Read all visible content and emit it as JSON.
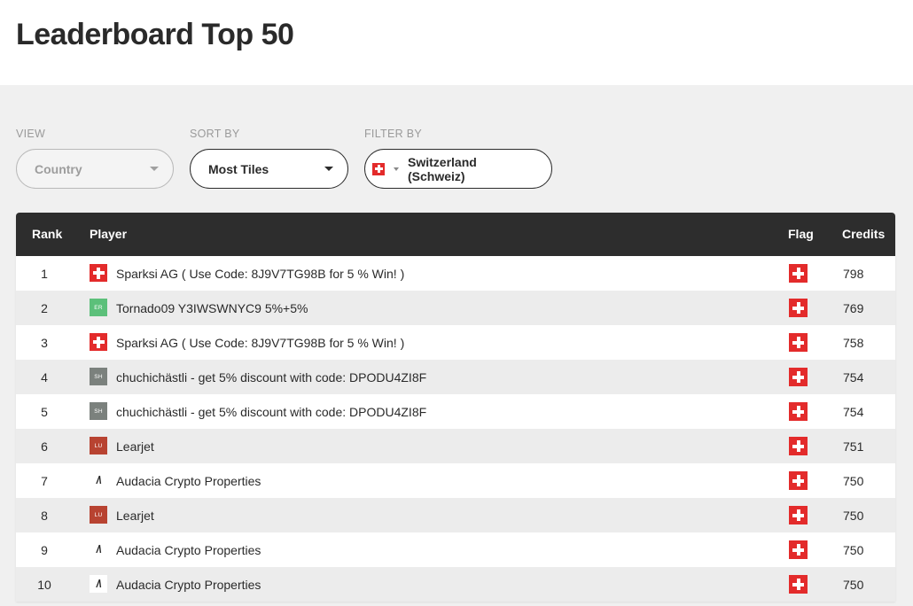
{
  "page": {
    "title": "Leaderboard Top 50"
  },
  "controls": {
    "view": {
      "label": "VIEW",
      "value": "Country",
      "disabled": true
    },
    "sort": {
      "label": "SORT BY",
      "value": "Most Tiles"
    },
    "filter": {
      "label": "FILTER BY",
      "value": "Switzerland (Schweiz)",
      "flag": "swiss-flag"
    }
  },
  "table": {
    "headers": {
      "rank": "Rank",
      "player": "Player",
      "flag": "Flag",
      "credits": "Credits"
    },
    "rows": [
      {
        "rank": "1",
        "avatar": "swiss-flag",
        "avatar_text": "",
        "player": "Sparksi AG ( Use Code: 8J9V7TG98B for 5 % Win! )",
        "flag": "swiss-flag",
        "credits": "798"
      },
      {
        "rank": "2",
        "avatar": "er",
        "avatar_text": "ER",
        "player": "Tornado09 Y3IWSWNYC9 5%+5%",
        "flag": "swiss-flag",
        "credits": "769"
      },
      {
        "rank": "3",
        "avatar": "swiss-flag",
        "avatar_text": "",
        "player": "Sparksi AG ( Use Code: 8J9V7TG98B for 5 % Win! )",
        "flag": "swiss-flag",
        "credits": "758"
      },
      {
        "rank": "4",
        "avatar": "sh",
        "avatar_text": "SH",
        "player": "chuchichästli - get 5% discount with code: DPODU4ZI8F",
        "flag": "swiss-flag",
        "credits": "754"
      },
      {
        "rank": "5",
        "avatar": "sh",
        "avatar_text": "SH",
        "player": "chuchichästli - get 5% discount with code: DPODU4ZI8F",
        "flag": "swiss-flag",
        "credits": "754"
      },
      {
        "rank": "6",
        "avatar": "lu",
        "avatar_text": "LU",
        "player": "Learjet",
        "flag": "swiss-flag",
        "credits": "751"
      },
      {
        "rank": "7",
        "avatar": "au",
        "avatar_text": "/\\",
        "player": "Audacia Crypto Properties",
        "flag": "swiss-flag",
        "credits": "750"
      },
      {
        "rank": "8",
        "avatar": "lu",
        "avatar_text": "LU",
        "player": "Learjet",
        "flag": "swiss-flag",
        "credits": "750"
      },
      {
        "rank": "9",
        "avatar": "au",
        "avatar_text": "/\\",
        "player": "Audacia Crypto Properties",
        "flag": "swiss-flag",
        "credits": "750"
      },
      {
        "rank": "10",
        "avatar": "au-boxed",
        "avatar_text": "/\\",
        "player": "Audacia Crypto Properties",
        "flag": "swiss-flag",
        "credits": "750"
      }
    ]
  }
}
